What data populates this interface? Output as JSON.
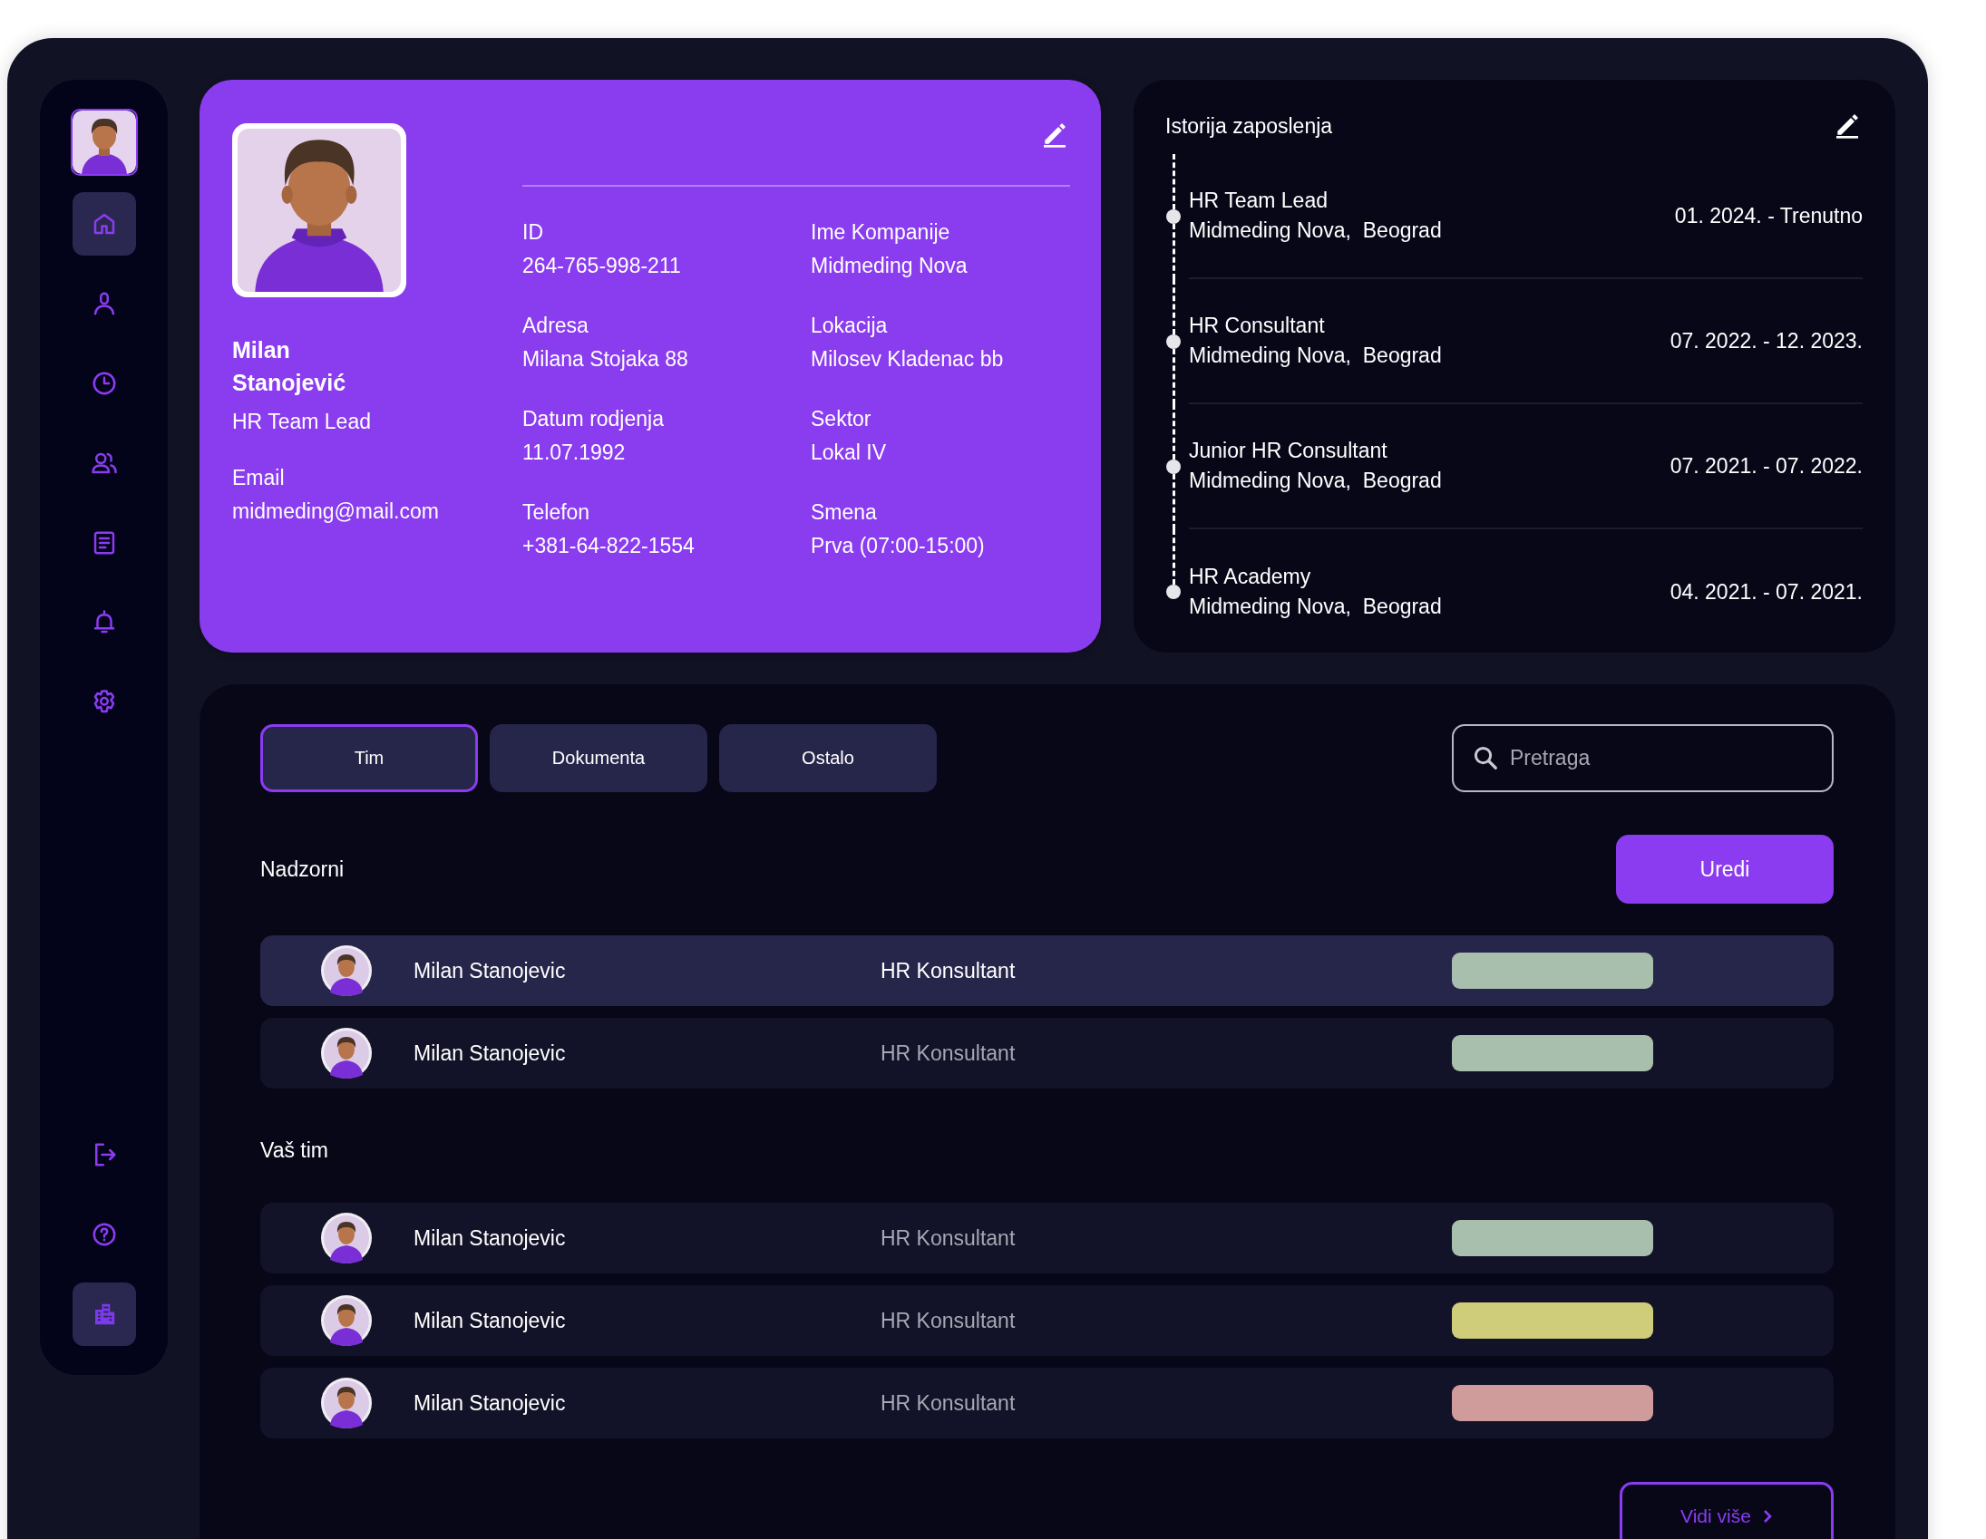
{
  "sidebar": {
    "items": [
      {
        "kind": "home",
        "selected": true
      },
      {
        "kind": "user",
        "selected": false
      },
      {
        "kind": "clock",
        "selected": false
      },
      {
        "kind": "users",
        "selected": false
      },
      {
        "kind": "document",
        "selected": false
      },
      {
        "kind": "bell",
        "selected": false
      },
      {
        "kind": "gear",
        "selected": false
      }
    ],
    "bottom_items": [
      {
        "kind": "logout",
        "selected": false
      },
      {
        "kind": "help",
        "selected": false
      },
      {
        "kind": "building",
        "selected": true
      }
    ]
  },
  "profile": {
    "name": "Milan Stanojević",
    "role": "HR Team Lead",
    "email_label": "Email",
    "email": "midmeding@mail.com",
    "fields": [
      {
        "label": "ID",
        "value": "264-765-998-211"
      },
      {
        "label": "Ime Kompanije",
        "value": "Midmeding Nova"
      },
      {
        "label": "Adresa",
        "value": "Milana Stojaka 88"
      },
      {
        "label": "Lokacija",
        "value": "Milosev Kladenac bb"
      },
      {
        "label": "Datum rodjenja",
        "value": "11.07.1992"
      },
      {
        "label": "Sektor",
        "value": "Lokal IV"
      },
      {
        "label": "Telefon",
        "value": "+381-64-822-1554"
      },
      {
        "label": "Smena",
        "value": "Prva (07:00-15:00)"
      }
    ]
  },
  "history": {
    "title": "Istorija zaposlenja",
    "entries": [
      {
        "position": "HR Team Lead",
        "company": "Midmeding Nova,  Beograd",
        "period": "01. 2024. - Trenutno"
      },
      {
        "position": "HR Consultant",
        "company": "Midmeding Nova,  Beograd",
        "period": "07. 2022. - 12. 2023."
      },
      {
        "position": "Junior HR Consultant",
        "company": "Midmeding Nova,  Beograd",
        "period": "07. 2021. - 07. 2022."
      },
      {
        "position": "HR Academy",
        "company": "Midmeding Nova,  Beograd",
        "period": "04. 2021. - 07. 2021."
      }
    ]
  },
  "tabs": [
    {
      "label": "Tim",
      "selected": true
    },
    {
      "label": "Dokumenta",
      "selected": false
    },
    {
      "label": "Ostalo",
      "selected": false
    }
  ],
  "search": {
    "placeholder": "Pretraga"
  },
  "edit_button": "Uredi",
  "groups": [
    {
      "title": "Nadzorni",
      "rows": [
        {
          "name": "Milan Stanojevic",
          "role": "HR Konsultant",
          "color": "#a9bfad",
          "selected": true
        },
        {
          "name": "Milan Stanojevic",
          "role": "HR Konsultant",
          "color": "#a9bfad",
          "selected": false
        }
      ]
    },
    {
      "title": "Vaš tim",
      "rows": [
        {
          "name": "Milan Stanojevic",
          "role": "HR Konsultant",
          "color": "#a9bfad",
          "selected": false
        },
        {
          "name": "Milan Stanojevic",
          "role": "HR Konsultant",
          "color": "#cfcd7a",
          "selected": false
        },
        {
          "name": "Milan Stanojevic",
          "role": "HR Konsultant",
          "color": "#cf9c9b",
          "selected": false
        }
      ]
    }
  ],
  "more_button": "Vidi više"
}
